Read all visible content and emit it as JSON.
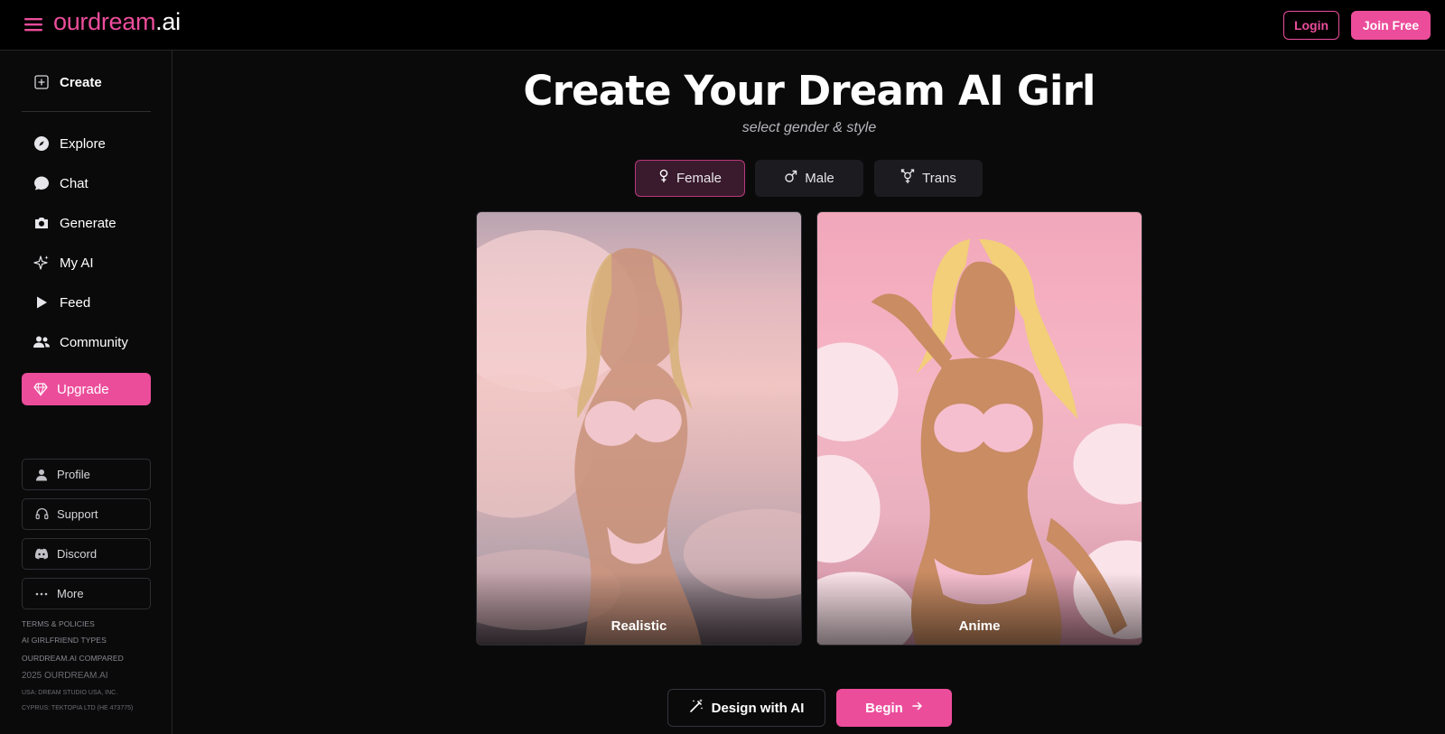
{
  "header": {
    "logo_brand": "ourdream",
    "logo_tld": ".ai",
    "login_label": "Login",
    "join_label": "Join Free"
  },
  "sidebar": {
    "create_label": "Create",
    "items": [
      {
        "label": "Explore",
        "icon": "compass-icon"
      },
      {
        "label": "Chat",
        "icon": "chat-bubble-icon"
      },
      {
        "label": "Generate",
        "icon": "camera-icon"
      },
      {
        "label": "My AI",
        "icon": "sparkles-icon"
      },
      {
        "label": "Feed",
        "icon": "play-icon"
      },
      {
        "label": "Community",
        "icon": "users-icon"
      }
    ],
    "upgrade_label": "Upgrade",
    "secondary": [
      {
        "label": "Profile",
        "icon": "user-icon"
      },
      {
        "label": "Support",
        "icon": "headset-icon"
      },
      {
        "label": "Discord",
        "icon": "discord-icon"
      },
      {
        "label": "More",
        "icon": "more-dots-icon"
      }
    ],
    "footer": {
      "terms": "TERMS & POLICIES",
      "types": "AI GIRLFRIEND TYPES",
      "compared": "OURDREAM.AI COMPARED",
      "copyright": "2025 OURDREAM.AI",
      "legal_usa": "USA: DREAM STUDIO USA, INC.",
      "legal_cyprus": "CYPRUS: TEKTOPIA LTD (HE 473775)"
    }
  },
  "main": {
    "title": "Create Your Dream AI Girl",
    "subtitle": "select gender & style",
    "tabs": [
      {
        "label": "Female",
        "active": true
      },
      {
        "label": "Male",
        "active": false
      },
      {
        "label": "Trans",
        "active": false
      }
    ],
    "styles": [
      {
        "label": "Realistic"
      },
      {
        "label": "Anime"
      }
    ],
    "design_label": "Design with AI",
    "begin_label": "Begin"
  },
  "colors": {
    "accent": "#ec4d9b",
    "background": "#0a0a0b",
    "header_bg": "#000000",
    "active_tab_bg": "#3a1a2d"
  }
}
